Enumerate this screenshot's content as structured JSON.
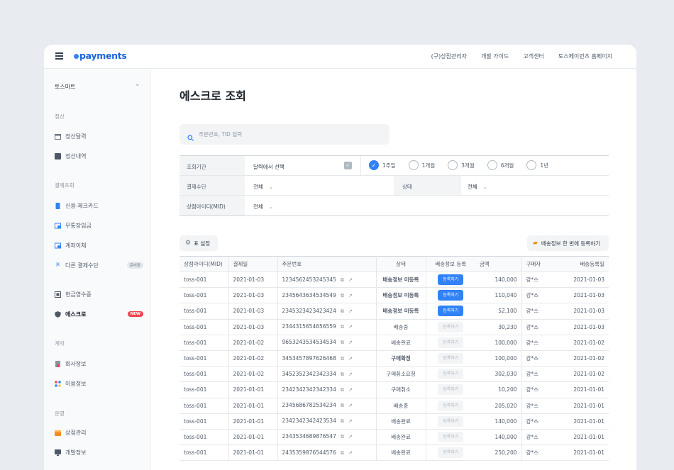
{
  "header": {
    "logo": "payments",
    "links": [
      "(구)상점관리자",
      "개발 가이드",
      "고객센터",
      "토스페이먼츠 홈페이지"
    ]
  },
  "sidebar": {
    "store": "토스마트",
    "sections": [
      {
        "title": "정산",
        "items": [
          {
            "label": "정산달력",
            "icon": "calendar-icon"
          },
          {
            "label": "정산내역",
            "icon": "ledger-icon"
          }
        ]
      },
      {
        "title": "결제조회",
        "items": [
          {
            "label": "신용·체크카드",
            "icon": "card-icon"
          },
          {
            "label": "무통장입금",
            "icon": "bank-icon"
          },
          {
            "label": "계좌이체",
            "icon": "transfer-icon"
          },
          {
            "label": "다른 결제수단",
            "icon": "sparkle-icon",
            "badge": "준비중"
          },
          {
            "label": "현금영수증",
            "icon": "receipt-icon"
          },
          {
            "label": "에스크로",
            "icon": "shield-icon",
            "badge": "NEW"
          }
        ]
      },
      {
        "title": "계약",
        "items": [
          {
            "label": "회사정보",
            "icon": "company-icon"
          },
          {
            "label": "이용정보",
            "icon": "apps-icon"
          }
        ]
      },
      {
        "title": "운영",
        "items": [
          {
            "label": "상점관리",
            "icon": "store-icon"
          },
          {
            "label": "개발정보",
            "icon": "monitor-icon"
          }
        ]
      }
    ]
  },
  "main": {
    "title": "에스크로 조회",
    "search_placeholder": "주문번호, TID 입력",
    "filters": {
      "period_label": "조회기간",
      "period_value": "달력에서 선택",
      "period_options": [
        "1주일",
        "1개월",
        "3개월",
        "6개월",
        "1년"
      ],
      "selected_option": "1주일",
      "method_label": "결제수단",
      "method_value": "전체",
      "status_label": "상태",
      "status_value": "전체",
      "mid_label": "상점아이디(MID)",
      "mid_value": "전체"
    },
    "table_settings": "표 설정",
    "bulk_button": "배송정보 한 번에 등록하기",
    "columns": [
      "상점아이디(MID)",
      "결제일",
      "주문번호",
      "상태",
      "배송정보 등록",
      "금액",
      "구매자",
      "배송등록일"
    ],
    "rows": [
      {
        "mid": "toss-001",
        "date": "2021-01-03",
        "order": "1234562453245345",
        "status": "배송정보 미등록",
        "status_type": "red",
        "reg": "등록하기",
        "reg_on": true,
        "amount": "140,000",
        "buyer": "강*스",
        "reg_date": "2021-01-03"
      },
      {
        "mid": "toss-001",
        "date": "2021-01-03",
        "order": "2345643634534549",
        "status": "배송정보 미등록",
        "status_type": "red",
        "reg": "등록하기",
        "reg_on": true,
        "amount": "110,040",
        "buyer": "강*스",
        "reg_date": "2021-01-03"
      },
      {
        "mid": "toss-001",
        "date": "2021-01-03",
        "order": "2345323423423424",
        "status": "배송정보 미등록",
        "status_type": "red",
        "reg": "등록하기",
        "reg_on": true,
        "amount": "52,100",
        "buyer": "강*스",
        "reg_date": "2021-01-03"
      },
      {
        "mid": "toss-001",
        "date": "2021-01-03",
        "order": "2344315654656559",
        "status": "배송중",
        "status_type": "normal",
        "reg": "등록하기",
        "reg_on": false,
        "amount": "30,230",
        "buyer": "강*스",
        "reg_date": "2021-01-03"
      },
      {
        "mid": "toss-001",
        "date": "2021-01-02",
        "order": "9653243534534534",
        "status": "배송완료",
        "status_type": "normal",
        "reg": "등록하기",
        "reg_on": false,
        "amount": "100,000",
        "buyer": "강*스",
        "reg_date": "2021-01-02"
      },
      {
        "mid": "toss-001",
        "date": "2021-01-02",
        "order": "3453457897626468",
        "status": "구매확정",
        "status_type": "blue",
        "reg": "등록하기",
        "reg_on": false,
        "amount": "100,000",
        "buyer": "강*스",
        "reg_date": "2021-01-02"
      },
      {
        "mid": "toss-001",
        "date": "2021-01-02",
        "order": "3452352342342334",
        "status": "구매취소요청",
        "status_type": "normal",
        "reg": "등록하기",
        "reg_on": false,
        "amount": "302,030",
        "buyer": "강*스",
        "reg_date": "2021-01-02"
      },
      {
        "mid": "toss-001",
        "date": "2021-01-01",
        "order": "2342342342342334",
        "status": "구매취소",
        "status_type": "normal",
        "reg": "등록하기",
        "reg_on": false,
        "amount": "10,200",
        "buyer": "강*스",
        "reg_date": "2021-01-01"
      },
      {
        "mid": "toss-001",
        "date": "2021-01-01",
        "order": "2345686782534234",
        "status": "배송중",
        "status_type": "normal",
        "reg": "등록하기",
        "reg_on": false,
        "amount": "205,020",
        "buyer": "강*스",
        "reg_date": "2021-01-01"
      },
      {
        "mid": "toss-001",
        "date": "2021-01-01",
        "order": "2342342342423534",
        "status": "배송완료",
        "status_type": "normal",
        "reg": "등록하기",
        "reg_on": false,
        "amount": "140,000",
        "buyer": "강*스",
        "reg_date": "2021-01-01"
      },
      {
        "mid": "toss-001",
        "date": "2021-01-01",
        "order": "2343534689876547",
        "status": "배송완료",
        "status_type": "normal",
        "reg": "등록하기",
        "reg_on": false,
        "amount": "140,000",
        "buyer": "강*스",
        "reg_date": "2021-01-01"
      },
      {
        "mid": "toss-001",
        "date": "2021-01-01",
        "order": "2435359876544576",
        "status": "배송완료",
        "status_type": "normal",
        "reg": "등록하기",
        "reg_on": false,
        "amount": "250,200",
        "buyer": "강*스",
        "reg_date": "2021-01-01"
      }
    ]
  },
  "colors": {
    "accent": "#3182f6",
    "danger": "#f04452",
    "brand": "#1b64da"
  }
}
